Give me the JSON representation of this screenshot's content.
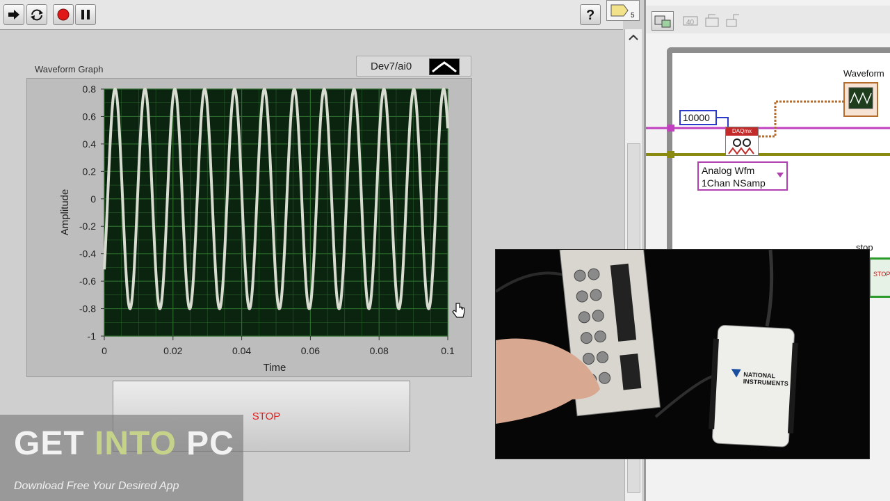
{
  "front_panel": {
    "graph": {
      "label": "Waveform Graph",
      "channel": "Dev7/ai0"
    },
    "stop_button": {
      "label": "STOP"
    }
  },
  "block_diagram": {
    "constant": "10000",
    "daqmx_vi_label": "DAQmx",
    "analog_selector": {
      "line1": "Analog Wfm",
      "line2": "1Chan NSamp"
    },
    "waveform_terminal_label": "Waveform",
    "stop_terminal_label": "stop",
    "stop_terminal_text": "STOP",
    "vi_icon_number": "5"
  },
  "video": {
    "device_brand_line1": "NATIONAL",
    "device_brand_line2": "INSTRUMENTS"
  },
  "watermark": {
    "title_part1": "GET ",
    "title_part2": "INTO",
    "title_part3": " PC",
    "subtitle": "Download Free Your Desired App"
  },
  "colors": {
    "plot_bg": "#0b2410",
    "plot_grid": "#2a6a2a",
    "trace": "#d8dcd0",
    "stop_text": "#e21c1c",
    "wire_pink": "#c040c0",
    "wire_yellow": "#8a8a10",
    "wire_orange": "#b56b2b"
  },
  "chart_data": {
    "type": "line",
    "title": "Waveform Graph",
    "xlabel": "Time",
    "ylabel": "Amplitude",
    "xlim": [
      0,
      0.1
    ],
    "ylim": [
      -1,
      0.8
    ],
    "x_ticks": [
      "0",
      "0.02",
      "0.04",
      "0.06",
      "0.08",
      "0.1"
    ],
    "y_ticks": [
      "0.8",
      "0.6",
      "0.4",
      "0.2",
      "0",
      "-0.2",
      "-0.4",
      "-0.6",
      "-0.8",
      "-1"
    ],
    "grid": true,
    "series": [
      {
        "function": "sine",
        "amplitude": 0.8,
        "offset": 0,
        "frequency_hz": 115,
        "phase_deg": -40
      }
    ]
  }
}
